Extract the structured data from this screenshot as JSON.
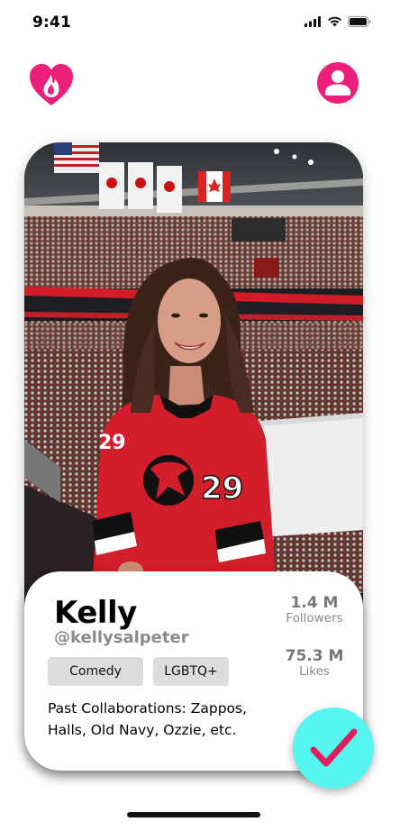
{
  "status_bar": {
    "time": "9:41"
  },
  "profile": {
    "name": "Kelly",
    "handle": "@kellysalpeter",
    "tags": [
      "Comedy",
      "LGBTQ+"
    ],
    "collaborations": "Past Collaborations: Zappos, Halls, Old Navy, Ozzie, etc.",
    "stats": [
      {
        "value": "1.4 M",
        "label": "Followers"
      },
      {
        "value": "75.3 M",
        "label": "Likes"
      }
    ]
  },
  "colors": {
    "brand": "#ec1f7b",
    "like_button": "#57f5f1",
    "check": "#e11d5c"
  },
  "icons": {
    "logo": "heart-flame-icon",
    "profile": "user-circle-icon",
    "like": "checkmark-icon"
  }
}
